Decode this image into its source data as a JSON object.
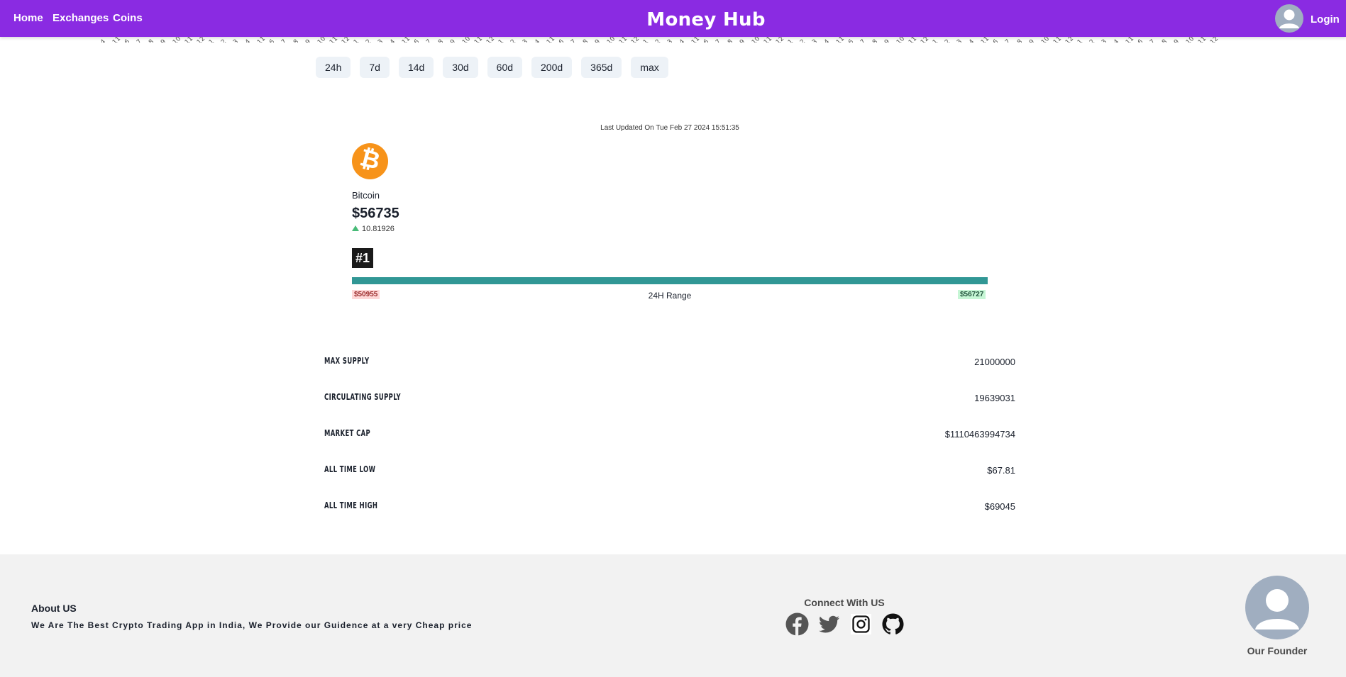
{
  "header": {
    "nav": [
      "Home",
      "Exchanges",
      "Coins"
    ],
    "brand": "Money Hub",
    "login": "Login"
  },
  "chart_axis": {
    "tick_labels": [
      "4",
      "11",
      "6",
      "7",
      "8",
      "9",
      "10",
      "11",
      "12",
      "1",
      "2",
      "3",
      "4",
      "11",
      "6",
      "7",
      "8",
      "9",
      "10",
      "11",
      "12",
      "1",
      "2",
      "3",
      "4",
      "11",
      "6",
      "7",
      "8",
      "9",
      "10",
      "11",
      "12",
      "1",
      "2",
      "3",
      "4",
      "11",
      "6",
      "7",
      "8",
      "9",
      "10",
      "11",
      "12",
      "1",
      "2",
      "3",
      "4",
      "11",
      "6",
      "7",
      "8",
      "9",
      "10",
      "11",
      "12",
      "1",
      "2",
      "3",
      "4",
      "11",
      "6",
      "7",
      "8",
      "9",
      "10",
      "11",
      "12",
      "1",
      "2",
      "3",
      "4",
      "11",
      "6",
      "7",
      "8",
      "9",
      "10",
      "11",
      "12",
      "1",
      "2",
      "3",
      "4",
      "11",
      "6",
      "7",
      "8",
      "9",
      "10",
      "11",
      "12",
      "1",
      "2"
    ]
  },
  "ranges": [
    "24h",
    "7d",
    "14d",
    "30d",
    "60d",
    "200d",
    "365d",
    "max"
  ],
  "updated": "Last Updated On Tue Feb 27 2024 15:51:35",
  "coin": {
    "symbol": "₿",
    "name": "Bitcoin",
    "price": "$56735",
    "change": "10.81926",
    "rank": "#1"
  },
  "range24h": {
    "low": "$50955",
    "label": "24H Range",
    "high": "$56727",
    "progress": 1.0
  },
  "stats": [
    {
      "label": "Max Supply",
      "value": "21000000"
    },
    {
      "label": "Circulating Supply",
      "value": "19639031"
    },
    {
      "label": "Market Cap",
      "value": "$1110463994734"
    },
    {
      "label": "All Time Low",
      "value": "$67.81"
    },
    {
      "label": "All Time High",
      "value": "$69045"
    }
  ],
  "footer": {
    "about_title": "About US",
    "about_text": "We Are The Best Crypto Trading App in India, We Provide our Guidence at a very Cheap price",
    "connect_title": "Connect With US",
    "socials": [
      "facebook-icon",
      "twitter-icon",
      "instagram-icon",
      "github-icon"
    ],
    "founder_label": "Our Founder"
  },
  "colors": {
    "header_bg": "#8a2be2",
    "accent_bar": "#319795",
    "positive": "#48bb78"
  }
}
